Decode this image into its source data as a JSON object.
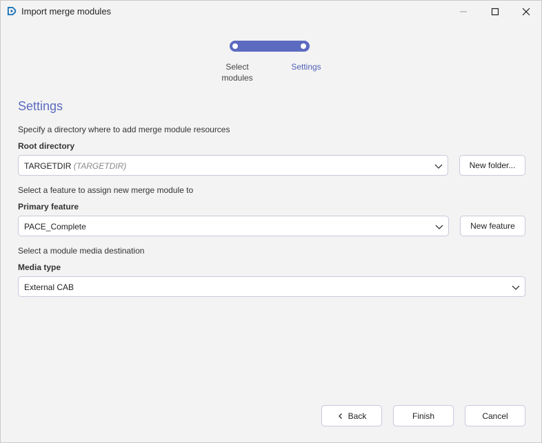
{
  "window": {
    "title": "Import merge modules",
    "controls": {
      "minimize": "minimize-icon",
      "maximize": "maximize-icon",
      "close": "close-icon"
    }
  },
  "stepper": {
    "steps": [
      {
        "label": "Select\nmodules",
        "state": "complete"
      },
      {
        "label": "Settings",
        "state": "current"
      }
    ],
    "accent": "#5c6bc0"
  },
  "page": {
    "heading": "Settings"
  },
  "root": {
    "hint": "Specify a directory where to add merge module resources",
    "label": "Root directory",
    "value": "TARGETDIR",
    "value_sub": "(TARGETDIR)",
    "button": "New folder..."
  },
  "feature": {
    "hint": "Select a feature to assign new merge module to",
    "label": "Primary feature",
    "value": "PACE_Complete",
    "button": "New feature"
  },
  "media": {
    "hint": "Select a module media destination",
    "label": "Media type",
    "value": "External CAB"
  },
  "footer": {
    "back": "Back",
    "finish": "Finish",
    "cancel": "Cancel"
  }
}
